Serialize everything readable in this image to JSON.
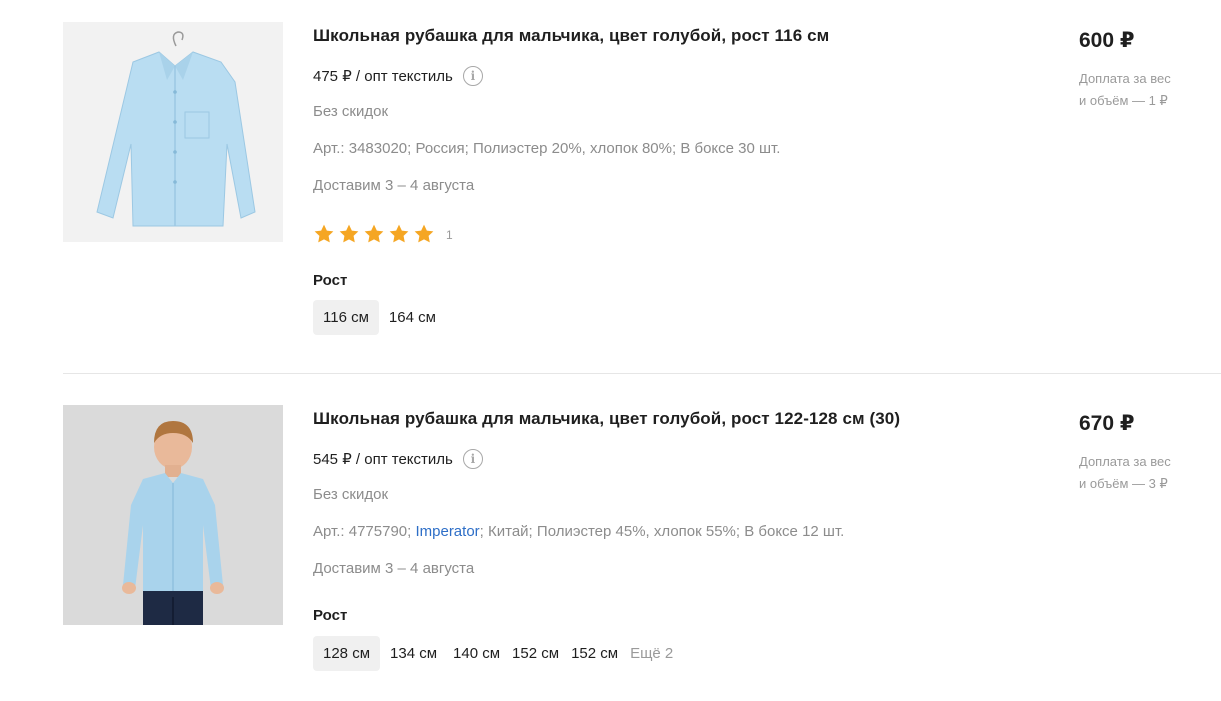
{
  "products": [
    {
      "title": "Школьная рубашка для мальчика, цвет голубой, рост 116 см",
      "wholesale": "475 ₽ / опт текстиль",
      "discount": "Без скидок",
      "specs": {
        "article": "Арт.: 3483020;",
        "country": "Россия;",
        "composition": "Полиэстер 20%, хлопок 80%;",
        "box": "В боксе 30 шт."
      },
      "delivery": "Доставим 3 – 4 августа",
      "rating": {
        "stars": 5,
        "count": "1"
      },
      "size_label": "Рост",
      "sizes": [
        "116 см",
        "164 см"
      ],
      "price": "600 ₽",
      "surcharge_line1": "Доплата за вес",
      "surcharge_line2": "и объём — 1 ₽"
    },
    {
      "title": "Школьная рубашка для мальчика, цвет голубой, рост 122-128 см (30)",
      "wholesale": "545 ₽ / опт текстиль",
      "discount": "Без скидок",
      "specs": {
        "article": "Арт.: 4775790;",
        "brand": "Imperator",
        "brand_sep": ";",
        "country": "Китай;",
        "composition": "Полиэстер 45%, хлопок 55%;",
        "box": "В боксе 12 шт."
      },
      "delivery": "Доставим 3 – 4 августа",
      "size_label": "Рост",
      "sizes": [
        "128 см",
        "134 см",
        "140 см",
        "152 см",
        "152 см"
      ],
      "more": "Ещё 2",
      "price": "670 ₽",
      "surcharge_line1": "Доплата за вес",
      "surcharge_line2": "и объём — 3 ₽"
    }
  ],
  "colors": {
    "star": "#f5a623",
    "brand_link": "#2d6ec7",
    "shirt": "#b9ddf2"
  }
}
